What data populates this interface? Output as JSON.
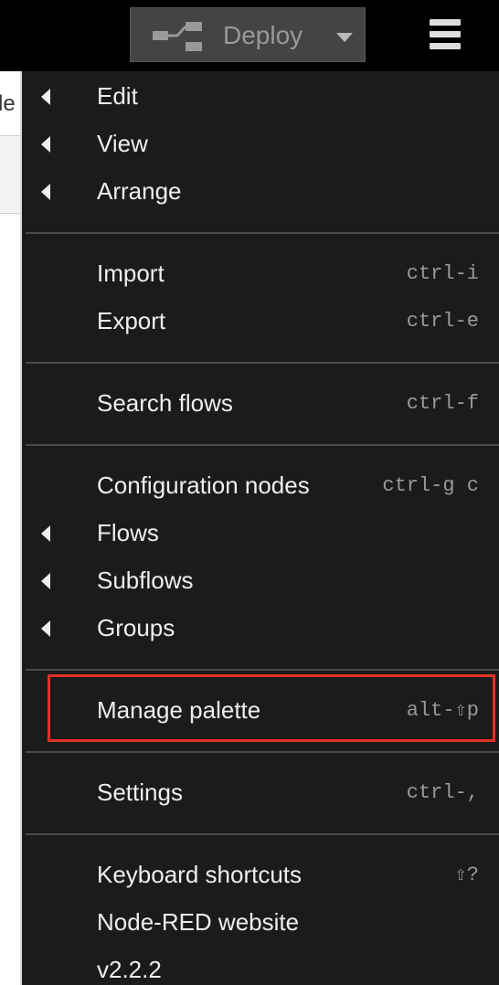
{
  "header": {
    "deploy_label": "Deploy",
    "deploy_icon": "deploy-flow-icon",
    "deploy_caret_icon": "caret-down-icon",
    "menu_icon": "hamburger-menu-icon"
  },
  "workspace": {
    "tab_label": "le"
  },
  "menu": {
    "items": [
      {
        "label": "Edit",
        "shortcut": "",
        "submenu": true
      },
      {
        "label": "View",
        "shortcut": "",
        "submenu": true
      },
      {
        "label": "Arrange",
        "shortcut": "",
        "submenu": true
      },
      {
        "label": "Import",
        "shortcut": "ctrl-i",
        "submenu": false
      },
      {
        "label": "Export",
        "shortcut": "ctrl-e",
        "submenu": false
      },
      {
        "label": "Search flows",
        "shortcut": "ctrl-f",
        "submenu": false
      },
      {
        "label": "Configuration nodes",
        "shortcut": "ctrl-g c",
        "submenu": false
      },
      {
        "label": "Flows",
        "shortcut": "",
        "submenu": true
      },
      {
        "label": "Subflows",
        "shortcut": "",
        "submenu": true
      },
      {
        "label": "Groups",
        "shortcut": "",
        "submenu": true
      },
      {
        "label": "Manage palette",
        "shortcut": "alt-⇧p",
        "submenu": false,
        "highlighted": true
      },
      {
        "label": "Settings",
        "shortcut": "ctrl-,",
        "submenu": false
      },
      {
        "label": "Keyboard shortcuts",
        "shortcut": "⇧?",
        "submenu": false
      },
      {
        "label": "Node-RED website",
        "shortcut": "",
        "submenu": false
      },
      {
        "label": "v2.2.2",
        "shortcut": "",
        "submenu": false
      }
    ],
    "highlight_color": "#e53027"
  },
  "colors": {
    "header_bg": "#000000",
    "menu_bg": "#1b1b1b",
    "deploy_bg": "#444444",
    "text": "#eeeeee",
    "shortcut_text": "#999999"
  }
}
